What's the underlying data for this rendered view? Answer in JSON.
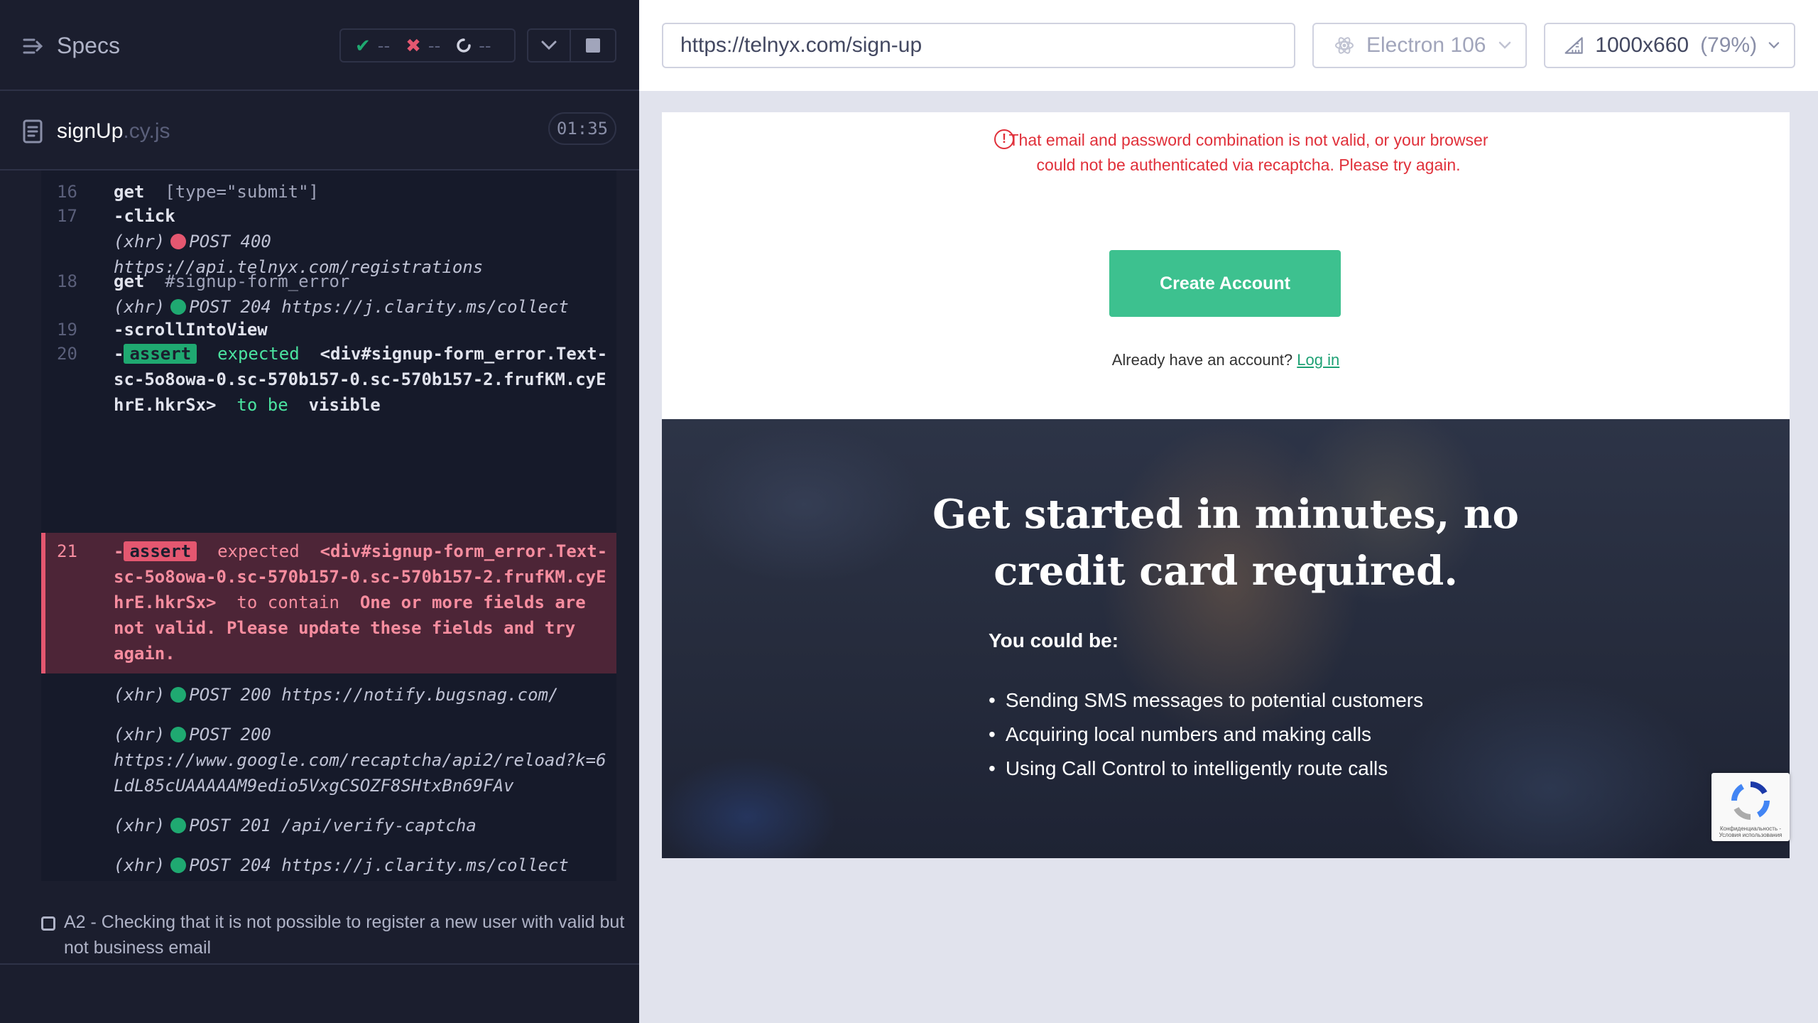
{
  "specs": {
    "title": "Specs",
    "passed": "--",
    "failed": "--",
    "pending": "--",
    "file_name": "signUp",
    "file_ext": ".cy.js",
    "duration": "01:35"
  },
  "commands": [
    {
      "num": "16",
      "name": "get",
      "message": "[type=\"submit\"]"
    },
    {
      "num": "17",
      "name": "-click"
    },
    {
      "num": "",
      "xhr": "(xhr)",
      "status": "POST 400",
      "url": "https://api.telnyx.com/registrations"
    },
    {
      "num": "18",
      "name": "get",
      "message": "#signup-form_error"
    },
    {
      "num": "",
      "xhr": "(xhr)",
      "status": "POST 204",
      "url": "https://j.clarity.ms/collect"
    },
    {
      "num": "19",
      "name": "-scrollIntoView"
    },
    {
      "num": "20",
      "name": "-",
      "badge": "assert",
      "expected": "expected",
      "subject": "<div#signup-form_error.Text-sc-5o8owa-0.sc-570b157-0.sc-570b157-2.frufKM.cyEhrE.hkrSx>",
      "verb": "to be",
      "value": "visible"
    },
    {
      "num": "21",
      "name": "-",
      "badge": "assert",
      "expected": "expected",
      "subject": "<div#signup-form_error.Text-sc-5o8owa-0.sc-570b157-0.sc-570b157-2.frufKM.cyEhrE.hkrSx>",
      "verb": "to contain",
      "value": "One or more fields are not valid. Please update these fields and try again."
    },
    {
      "num": "",
      "xhr": "(xhr)",
      "status": "POST 200",
      "url": "https://notify.bugsnag.com/"
    },
    {
      "num": "",
      "xhr": "(xhr)",
      "status": "POST 200",
      "url": "https://www.google.com/recaptcha/api2/reload?k=6LdL85cUAAAAAM9edio5VxgCSOZF8SHtxBn69FAv"
    },
    {
      "num": "",
      "xhr": "(xhr)",
      "status": "POST 201",
      "url": "/api/verify-captcha"
    },
    {
      "num": "",
      "xhr": "(xhr)",
      "status": "POST 204",
      "url": "https://j.clarity.ms/collect"
    }
  ],
  "next_test": "A2 - Checking that it is not possible to register a new user with valid but not business email",
  "browser_bar": {
    "url": "https://telnyx.com/sign-up",
    "browser": "Electron 106",
    "viewport": "1000x660",
    "zoom": "(79%)"
  },
  "aut": {
    "error_message": "That email and password combination is not valid, or your browser could not be authenticated via recaptcha. Please try again.",
    "cta_label": "Create Account",
    "login_prompt": "Already have an account?",
    "login_link": "Log in",
    "hero_title_line1": "Get started in minutes, no",
    "hero_title_line2": "credit card required.",
    "hero_sub": "You could be:",
    "hero_items": [
      "Sending SMS messages to potential customers",
      "Acquiring local numbers and making calls",
      "Using Call Control to intelligently route calls"
    ],
    "recaptcha_text": "Конфиденциальность - Условия использования"
  },
  "colors": {
    "pass": "#1fa971",
    "fail": "#e45770",
    "cta": "#3dc18f",
    "error": "#e0303a"
  }
}
